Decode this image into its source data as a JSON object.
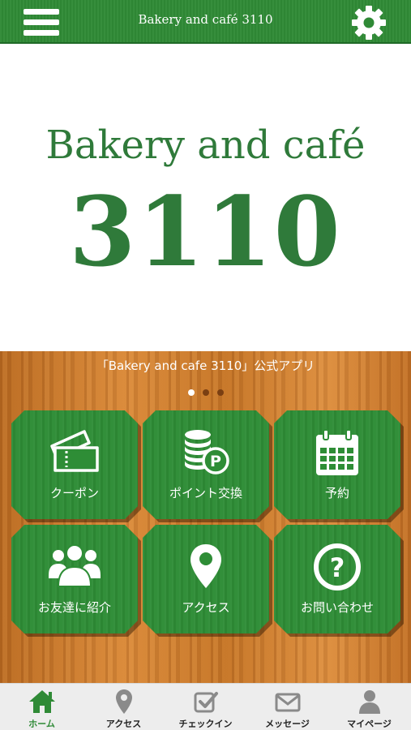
{
  "header": {
    "title": "Bakery and café 3110",
    "menu_icon": "hamburger-menu-icon",
    "settings_icon": "gear-icon",
    "color": "#2f8a36"
  },
  "logo": {
    "line1": "Bakery and café",
    "line2": "3110",
    "color": "#2f7a3a"
  },
  "banner": {
    "text": "「Bakery and cafe 3110」公式アプリ",
    "page_count": 3,
    "active_page": 1
  },
  "tiles": [
    {
      "label": "クーポン",
      "icon": "ticket-icon"
    },
    {
      "label": "ポイント交換",
      "icon": "coins-point-icon"
    },
    {
      "label": "予約",
      "icon": "calendar-icon"
    },
    {
      "label": "お友達に紹介",
      "icon": "users-group-icon"
    },
    {
      "label": "アクセス",
      "icon": "map-pin-icon"
    },
    {
      "label": "お問い合わせ",
      "icon": "question-circle-icon"
    }
  ],
  "tabbar": {
    "active_color": "#2f8a36",
    "items": [
      {
        "label": "ホーム",
        "icon": "home-icon",
        "active": true
      },
      {
        "label": "アクセス",
        "icon": "map-pin-icon",
        "active": false
      },
      {
        "label": "チェックイン",
        "icon": "checkbox-icon",
        "active": false
      },
      {
        "label": "メッセージ",
        "icon": "envelope-icon",
        "active": false
      },
      {
        "label": "マイページ",
        "icon": "user-icon",
        "active": false
      }
    ]
  }
}
